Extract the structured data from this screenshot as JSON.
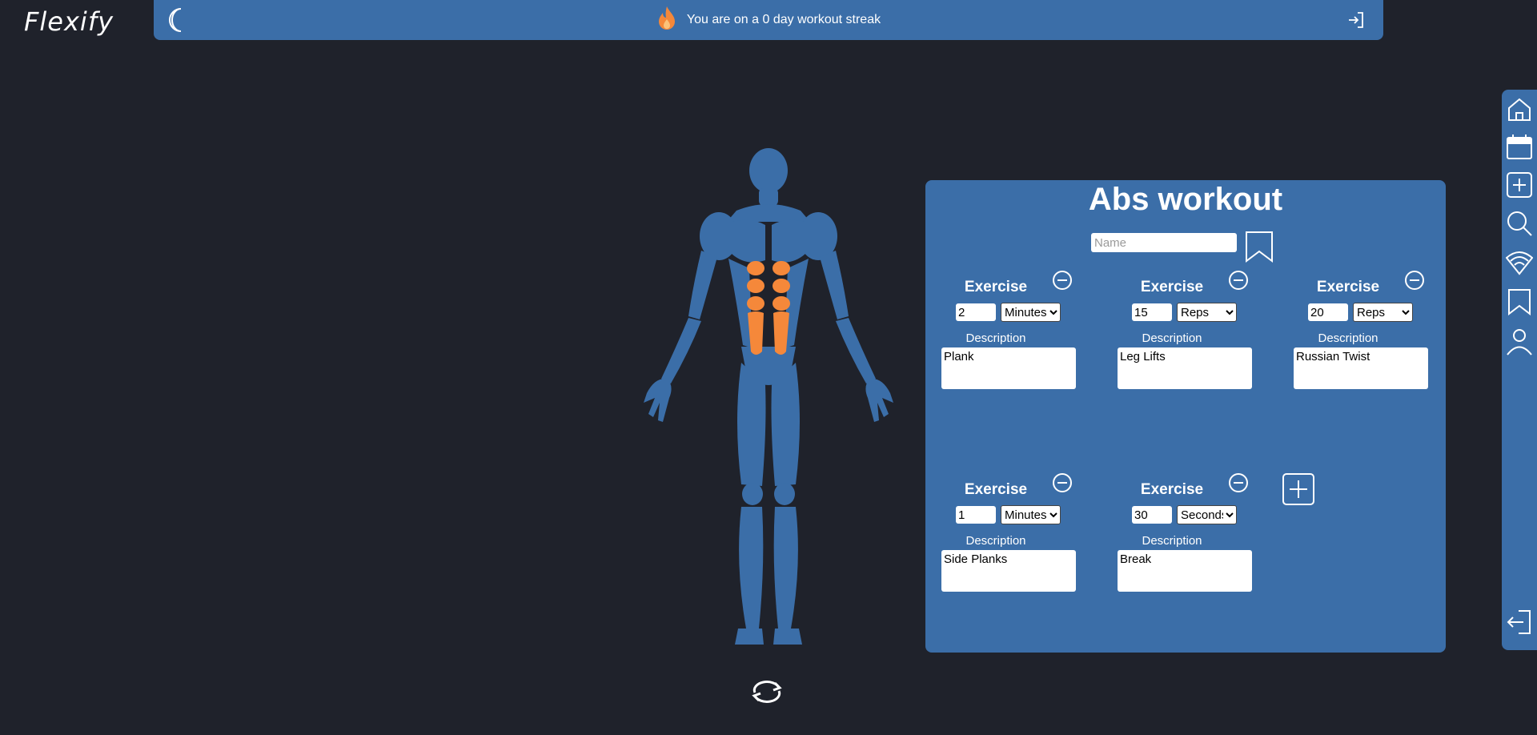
{
  "app": {
    "logo": "Flexify"
  },
  "topbar": {
    "streak_text": "You are on a 0 day workout streak",
    "icons": [
      "moon-icon",
      "flame-icon",
      "login-icon"
    ]
  },
  "colors": {
    "accent": "#3b6ea8",
    "background": "#1f222b",
    "highlight": "#f5883a"
  },
  "body_view": {
    "highlighted_muscles": "abs",
    "icons": [
      "rotate-icon"
    ]
  },
  "workout": {
    "title": "Abs workout",
    "name_placeholder": "Name",
    "exercise_label": "Exercise",
    "description_label": "Description",
    "exercises": [
      {
        "amount": "2",
        "unit": "Minutes",
        "description": "Plank"
      },
      {
        "amount": "15",
        "unit": "Reps",
        "description": "Leg Lifts"
      },
      {
        "amount": "20",
        "unit": "Reps",
        "description": "Russian Twist"
      },
      {
        "amount": "1",
        "unit": "Minutes",
        "description": "Side Planks"
      },
      {
        "amount": "30",
        "unit": "Seconds",
        "description": "Break"
      }
    ]
  },
  "sidebar": {
    "items": [
      "home-icon",
      "calendar-icon",
      "plus-icon",
      "search-icon",
      "wifi-icon",
      "bookmark-icon",
      "user-icon",
      "logout-icon"
    ]
  }
}
